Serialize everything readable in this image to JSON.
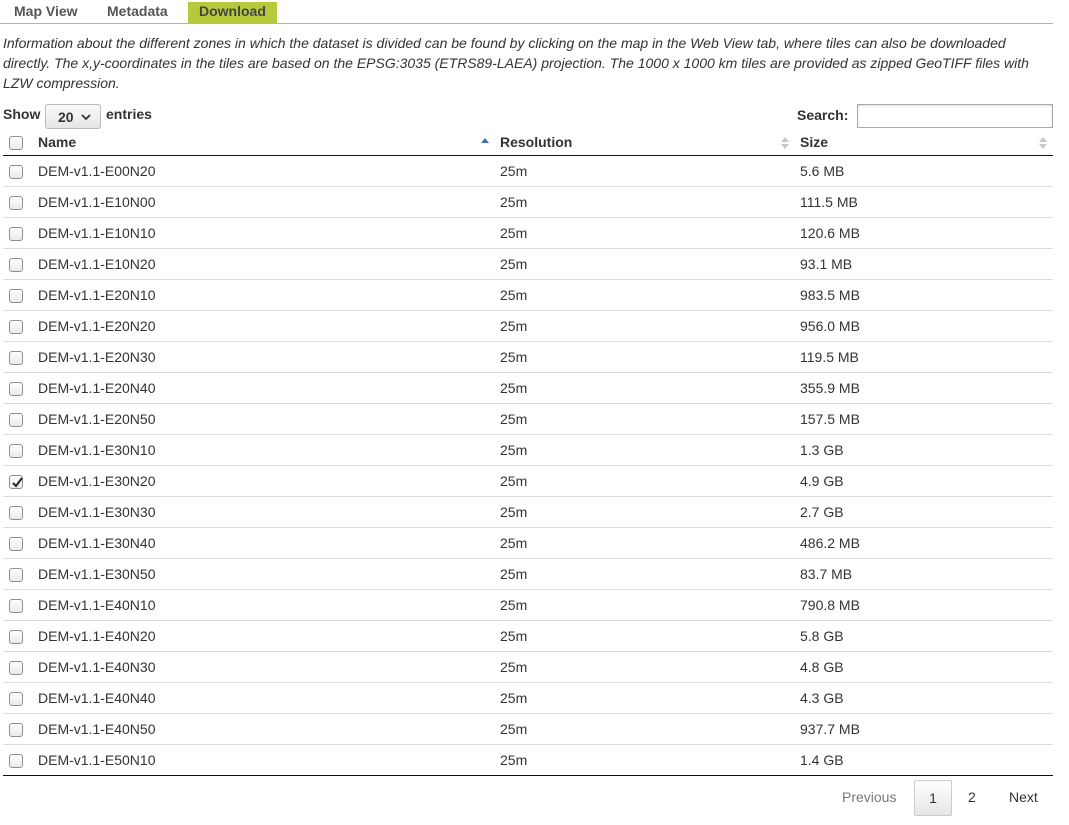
{
  "tabs": [
    {
      "label": "Map View",
      "active": false
    },
    {
      "label": "Metadata",
      "active": false
    },
    {
      "label": "Download",
      "active": true
    }
  ],
  "info_text": "Information about the different zones in which the dataset is divided can be found by clicking on the map in the Web View tab, where tiles can also be downloaded directly. The x,y-coordinates in the tiles are based on the EPSG:3035 (ETRS89-LAEA) projection. The 1000 x 1000 km tiles are provided as zipped GeoTIFF files with LZW compression.",
  "length": {
    "show_label": "Show",
    "selected": "20",
    "entries_label": "entries"
  },
  "search": {
    "label": "Search:",
    "value": ""
  },
  "table": {
    "columns": [
      "Name",
      "Resolution",
      "Size"
    ],
    "sorted_column": "Name",
    "sort_direction": "ascending",
    "rows": [
      {
        "name": "DEM-v1.1-E00N20",
        "resolution": "25m",
        "size": "5.6 MB",
        "checked": false
      },
      {
        "name": "DEM-v1.1-E10N00",
        "resolution": "25m",
        "size": "111.5 MB",
        "checked": false
      },
      {
        "name": "DEM-v1.1-E10N10",
        "resolution": "25m",
        "size": "120.6 MB",
        "checked": false
      },
      {
        "name": "DEM-v1.1-E10N20",
        "resolution": "25m",
        "size": "93.1 MB",
        "checked": false
      },
      {
        "name": "DEM-v1.1-E20N10",
        "resolution": "25m",
        "size": "983.5 MB",
        "checked": false
      },
      {
        "name": "DEM-v1.1-E20N20",
        "resolution": "25m",
        "size": "956.0 MB",
        "checked": false
      },
      {
        "name": "DEM-v1.1-E20N30",
        "resolution": "25m",
        "size": "119.5 MB",
        "checked": false
      },
      {
        "name": "DEM-v1.1-E20N40",
        "resolution": "25m",
        "size": "355.9 MB",
        "checked": false
      },
      {
        "name": "DEM-v1.1-E20N50",
        "resolution": "25m",
        "size": "157.5 MB",
        "checked": false
      },
      {
        "name": "DEM-v1.1-E30N10",
        "resolution": "25m",
        "size": "1.3 GB",
        "checked": false
      },
      {
        "name": "DEM-v1.1-E30N20",
        "resolution": "25m",
        "size": "4.9 GB",
        "checked": true
      },
      {
        "name": "DEM-v1.1-E30N30",
        "resolution": "25m",
        "size": "2.7 GB",
        "checked": false
      },
      {
        "name": "DEM-v1.1-E30N40",
        "resolution": "25m",
        "size": "486.2 MB",
        "checked": false
      },
      {
        "name": "DEM-v1.1-E30N50",
        "resolution": "25m",
        "size": "83.7 MB",
        "checked": false
      },
      {
        "name": "DEM-v1.1-E40N10",
        "resolution": "25m",
        "size": "790.8 MB",
        "checked": false
      },
      {
        "name": "DEM-v1.1-E40N20",
        "resolution": "25m",
        "size": "5.8 GB",
        "checked": false
      },
      {
        "name": "DEM-v1.1-E40N30",
        "resolution": "25m",
        "size": "4.8 GB",
        "checked": false
      },
      {
        "name": "DEM-v1.1-E40N40",
        "resolution": "25m",
        "size": "4.3 GB",
        "checked": false
      },
      {
        "name": "DEM-v1.1-E40N50",
        "resolution": "25m",
        "size": "937.7 MB",
        "checked": false
      },
      {
        "name": "DEM-v1.1-E50N10",
        "resolution": "25m",
        "size": "1.4 GB",
        "checked": false
      }
    ]
  },
  "pagination": {
    "previous": "Previous",
    "pages": [
      "1",
      "2"
    ],
    "current": "1",
    "next": "Next"
  },
  "colors": {
    "accent": "#b5c93a",
    "sort_active": "#4a6fb5",
    "sort_inactive": "#c8c8c8"
  }
}
